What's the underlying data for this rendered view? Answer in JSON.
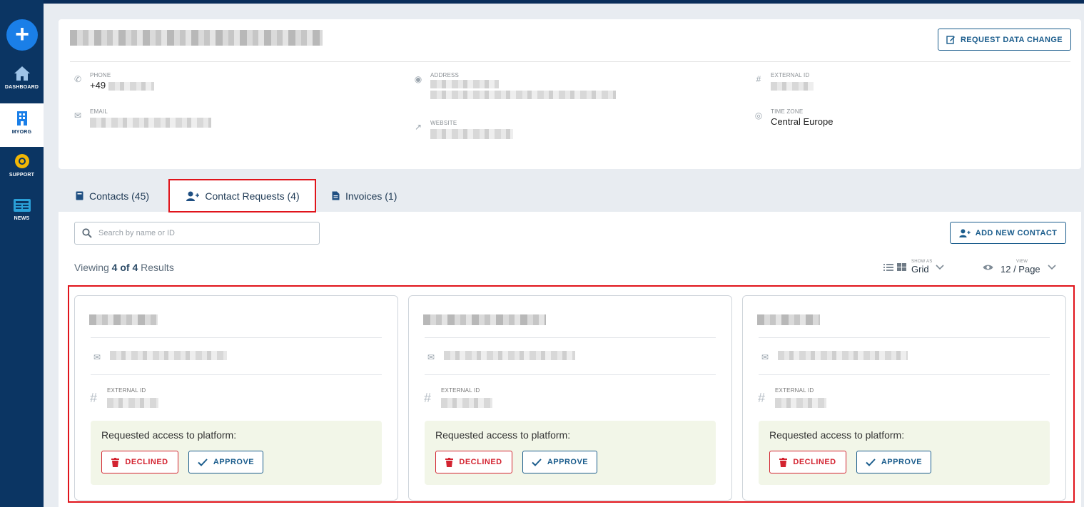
{
  "sidebar": {
    "items": [
      {
        "label": "DASHBOARD",
        "icon": "home-icon"
      },
      {
        "label": "MYORG",
        "icon": "building-icon"
      },
      {
        "label": "SUPPORT",
        "icon": "lifebuoy-icon"
      },
      {
        "label": "NEWS",
        "icon": "newspaper-icon"
      }
    ]
  },
  "org": {
    "request_change_label": "REQUEST DATA CHANGE",
    "phone_label": "PHONE",
    "phone_value": "+49",
    "email_label": "EMAIL",
    "address_label": "ADDRESS",
    "website_label": "WEBSITE",
    "external_id_label": "EXTERNAL ID",
    "timezone_label": "TIME ZONE",
    "timezone_value": "Central Europe"
  },
  "tabs": [
    {
      "label": "Contacts (45)",
      "icon": "book-icon"
    },
    {
      "label": "Contact Requests (4)",
      "icon": "user-plus-icon"
    },
    {
      "label": "Invoices (1)",
      "icon": "document-icon"
    }
  ],
  "toolbar": {
    "search_placeholder": "Search by name or ID",
    "add_contact_label": "ADD NEW CONTACT",
    "viewing_prefix": "Viewing",
    "viewing_count": "4 of 4",
    "viewing_suffix": "Results",
    "show_as_label": "SHOW AS",
    "show_as_value": "Grid",
    "view_label": "VIEW",
    "view_value": "12 / Page"
  },
  "requests": [
    {
      "external_id_label": "EXTERNAL ID",
      "request_text": "Requested access to platform:",
      "decline_label": "DECLINED",
      "approve_label": "APPROVE"
    },
    {
      "external_id_label": "EXTERNAL ID",
      "request_text": "Requested access to platform:",
      "decline_label": "DECLINED",
      "approve_label": "APPROVE"
    },
    {
      "external_id_label": "EXTERNAL ID",
      "request_text": "Requested access to platform:",
      "decline_label": "DECLINED",
      "approve_label": "APPROVE"
    }
  ],
  "colors": {
    "sidebar_bg": "#0b3563",
    "accent_blue": "#1a5c8c",
    "decline_red": "#d32330",
    "highlight_red": "#e0141b",
    "request_box_bg": "#f2f6e8"
  }
}
